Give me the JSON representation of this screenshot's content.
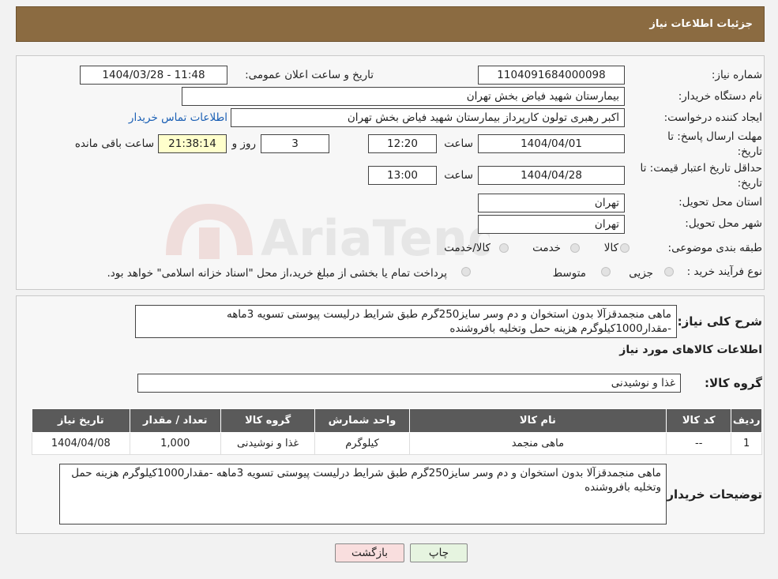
{
  "header": {
    "title": "جزئیات اطلاعات نیاز"
  },
  "form": {
    "need_number_label": "شماره نیاز:",
    "need_number": "1104091684000098",
    "announce_label": "تاریخ و ساعت اعلان عمومی:",
    "announce_value": "1404/03/28 - 11:48",
    "buyer_org_label": "نام دستگاه خریدار:",
    "buyer_org": "بیمارستان شهید فیاض بخش تهران",
    "creator_label": "ایجاد کننده درخواست:",
    "creator": "اکبر رهبری تولون کارپرداز بیمارستان شهید فیاض بخش تهران",
    "contact_link": "اطلاعات تماس خریدار",
    "deadline_label_1": "مهلت ارسال پاسخ: تا",
    "deadline_label_2": "تاریخ:",
    "deadline_date": "1404/04/01",
    "time_label": "ساعت",
    "deadline_time": "12:20",
    "days_value": "3",
    "days_label": "روز و",
    "remaining_value": "21:38:14",
    "remaining_label": "ساعت باقی مانده",
    "validity_label_1": "حداقل تاریخ اعتبار قیمت: تا",
    "validity_label_2": "تاریخ:",
    "validity_date": "1404/04/28",
    "validity_time": "13:00",
    "province_label": "استان محل تحویل:",
    "province": "تهران",
    "city_label": "شهر محل تحویل:",
    "city": "تهران",
    "category_label": "طبقه بندی موضوعی:",
    "category_options": [
      "کالا",
      "خدمت",
      "کالا/خدمت"
    ],
    "process_label": "نوع فرآیند خرید :",
    "process_options": [
      "جزیی",
      "متوسط"
    ],
    "process_note": "پرداخت تمام یا بخشی از مبلغ خرید،از محل \"اسناد خزانه اسلامی\" خواهد بود."
  },
  "description": {
    "label": "شرح کلی نیاز:",
    "text": "ماهی منجمدقزآلا بدون استخوان و دم وسر سایز250گرم طبق شرایط درلیست پیوستی تسویه 3ماهه -مقدار1000کیلوگرم هزینه حمل  وتخلیه بافروشنده",
    "goods_info_title": "اطلاعات کالاهای مورد نیاز",
    "goods_group_label": "گروه کالا:",
    "goods_group": "غذا و نوشیدنی"
  },
  "table": {
    "headers": [
      "ردیف",
      "کد کالا",
      "نام کالا",
      "واحد شمارش",
      "گروه کالا",
      "تعداد / مقدار",
      "تاریخ نیاز"
    ],
    "rows": [
      [
        "1",
        "--",
        "ماهی منجمد",
        "کیلوگرم",
        "غذا و نوشیدنی",
        "1,000",
        "1404/04/08"
      ]
    ]
  },
  "buyer_notes": {
    "label": "توضیحات خریدار:",
    "text": "ماهی منجمدقزآلا بدون استخوان و دم وسر سایز250گرم طبق شرایط درلیست پیوستی تسویه 3ماهه -مقدار1000کیلوگرم هزینه حمل  وتخلیه بافروشنده"
  },
  "buttons": {
    "print": "چاپ",
    "back": "بازگشت"
  },
  "watermark": {
    "text": "AriaTender.neT"
  },
  "colors": {
    "header_bg": "#8b6b41",
    "table_header_bg": "#5a5a5a",
    "remaining_bg": "#ffffcc",
    "back_button_bg": "#f9dede",
    "print_button_bg": "#e6f4e0"
  }
}
